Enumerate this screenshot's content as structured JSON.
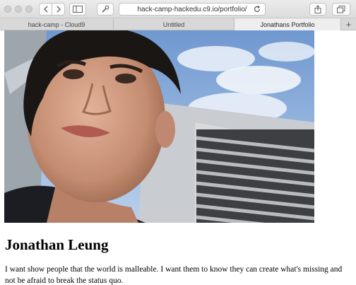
{
  "browser": {
    "url": "hack-camp-hackedu.c9.io/portfolio/",
    "tabs": [
      {
        "label": "hack-camp - Cloud9",
        "active": false
      },
      {
        "label": "Untitled",
        "active": false
      },
      {
        "label": "Jonathans Portfolio",
        "active": true
      }
    ],
    "new_tab_label": "+"
  },
  "page": {
    "name": "Jonathan Leung",
    "bio": "I want show people that the world is malleable. I want them to know they can create what's missing and not be afraid to break the status quo."
  },
  "icons": {
    "back": "chevron-left-icon",
    "forward": "chevron-right-icon",
    "sidebar": "sidebar-icon",
    "tools": "wrench-icon",
    "reload": "reload-icon",
    "share": "share-icon",
    "tabs": "tabs-icon",
    "close_tab": "close-icon"
  },
  "colors": {
    "sky": "#8fb4e0",
    "wall": "#c9ccd0",
    "hair": "#1a1614",
    "skin": "#c99478"
  }
}
